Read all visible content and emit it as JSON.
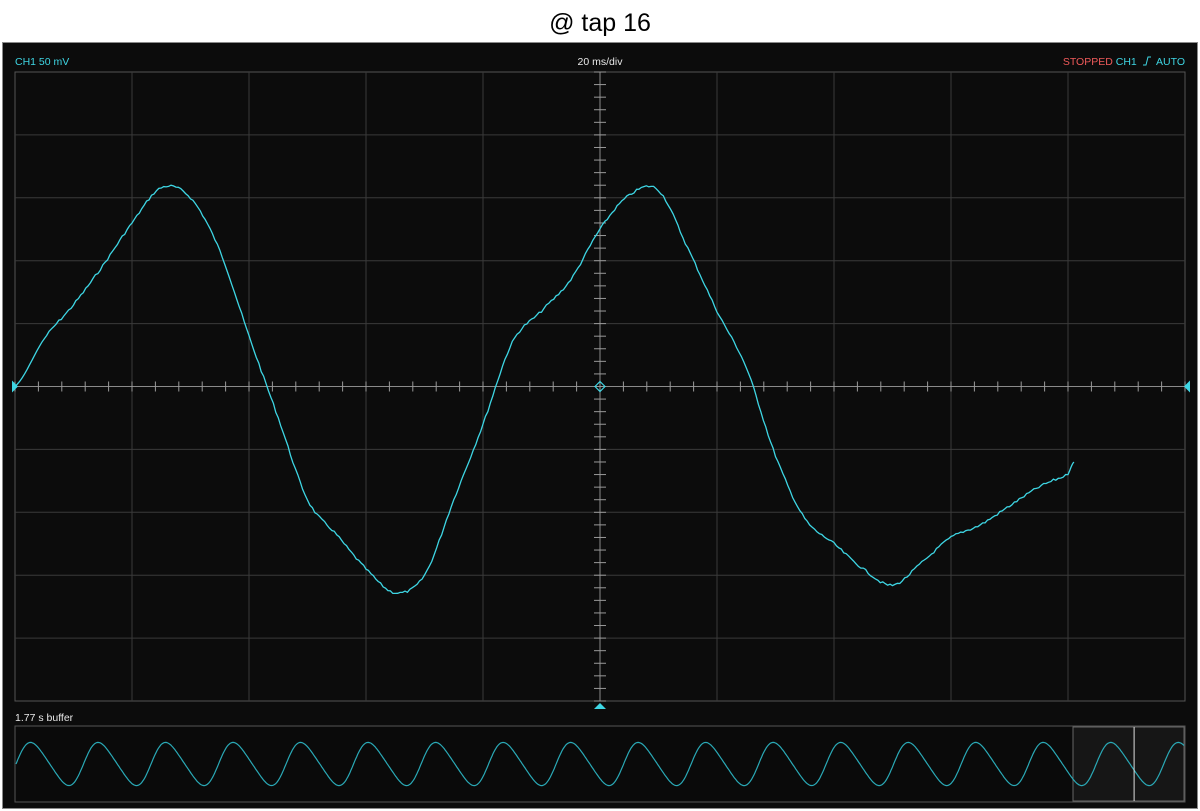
{
  "page_title": "@ tap 16",
  "scope": {
    "channel_label": "CH1 50 mV",
    "timebase": "20 ms/div",
    "status": "STOPPED",
    "trigger_channel": "CH1",
    "trigger_mode": "AUTO",
    "trigger_edge_icon": "rising-edge-icon",
    "buffer_label": "1.77 s buffer"
  },
  "colors": {
    "trace": "#3ed6e4",
    "status": "#f05a5a",
    "grid": "#3a3a3a",
    "background": "#0c0c0c"
  },
  "chart_data": {
    "type": "line",
    "title": "@ tap 16",
    "grid": true,
    "x_divisions": 10,
    "y_divisions": 10,
    "x_unit": "ms",
    "y_unit": "mV",
    "x_per_div": 20,
    "y_per_div": 50,
    "xlim": [
      -100,
      100
    ],
    "ylim": [
      -250,
      250
    ],
    "series": [
      {
        "x": [
          -100,
          -95,
          -90,
          -85,
          -80,
          -75,
          -70,
          -65,
          -60,
          -55,
          -50,
          -45,
          -40,
          -35,
          -30,
          -25,
          -20,
          -15,
          -10,
          -5,
          0,
          5,
          10,
          15,
          20,
          25,
          30,
          35,
          40,
          45,
          50,
          55,
          60,
          65,
          70,
          75,
          80,
          81
        ],
        "y": [
          0,
          38,
          65,
          96,
          130,
          158,
          150,
          108,
          40,
          -25,
          -90,
          -118,
          -145,
          -164,
          -150,
          -90,
          -30,
          35,
          60,
          85,
          125,
          152,
          156,
          110,
          60,
          15,
          -55,
          -105,
          -125,
          -145,
          -158,
          -140,
          -120,
          -110,
          -95,
          -80,
          -70,
          -60
        ]
      }
    ],
    "buffer_overview": {
      "duration_s": 1.77,
      "cycles": 17,
      "window_start_fraction": 0.905
    }
  }
}
